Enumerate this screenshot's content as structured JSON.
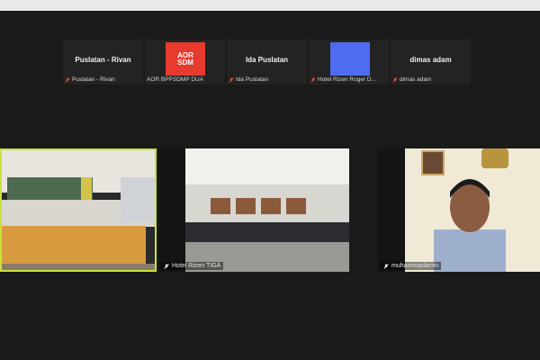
{
  "thumbnails": [
    {
      "name": "Puslatan - Rivan",
      "caption": "Puslatan - Rivan",
      "kind": "name"
    },
    {
      "name": "",
      "caption": "AOR BPPSDMP DUA",
      "kind": "logo",
      "logo_lines": [
        "AOR",
        "SDM"
      ],
      "logo_color": "#e63b2e"
    },
    {
      "name": "Ida Puslatan",
      "caption": "Ida Puslatan",
      "kind": "name"
    },
    {
      "name": "",
      "caption": "Hotel Rizen Roger D...",
      "kind": "blue",
      "tile_color": "#4d6cf0"
    },
    {
      "name": "dimas adam",
      "caption": "dimas adam",
      "kind": "name"
    }
  ],
  "tiles": [
    {
      "caption": "",
      "highlight_color": "#c9e23a"
    },
    {
      "caption": "Hotel Rizen TIGA"
    },
    {
      "caption": "muhammadamin"
    }
  ],
  "colors": {
    "active_speaker_border": "#c9e23a",
    "muted_mic": "#e14a3b",
    "background": "#1a1a1a"
  }
}
